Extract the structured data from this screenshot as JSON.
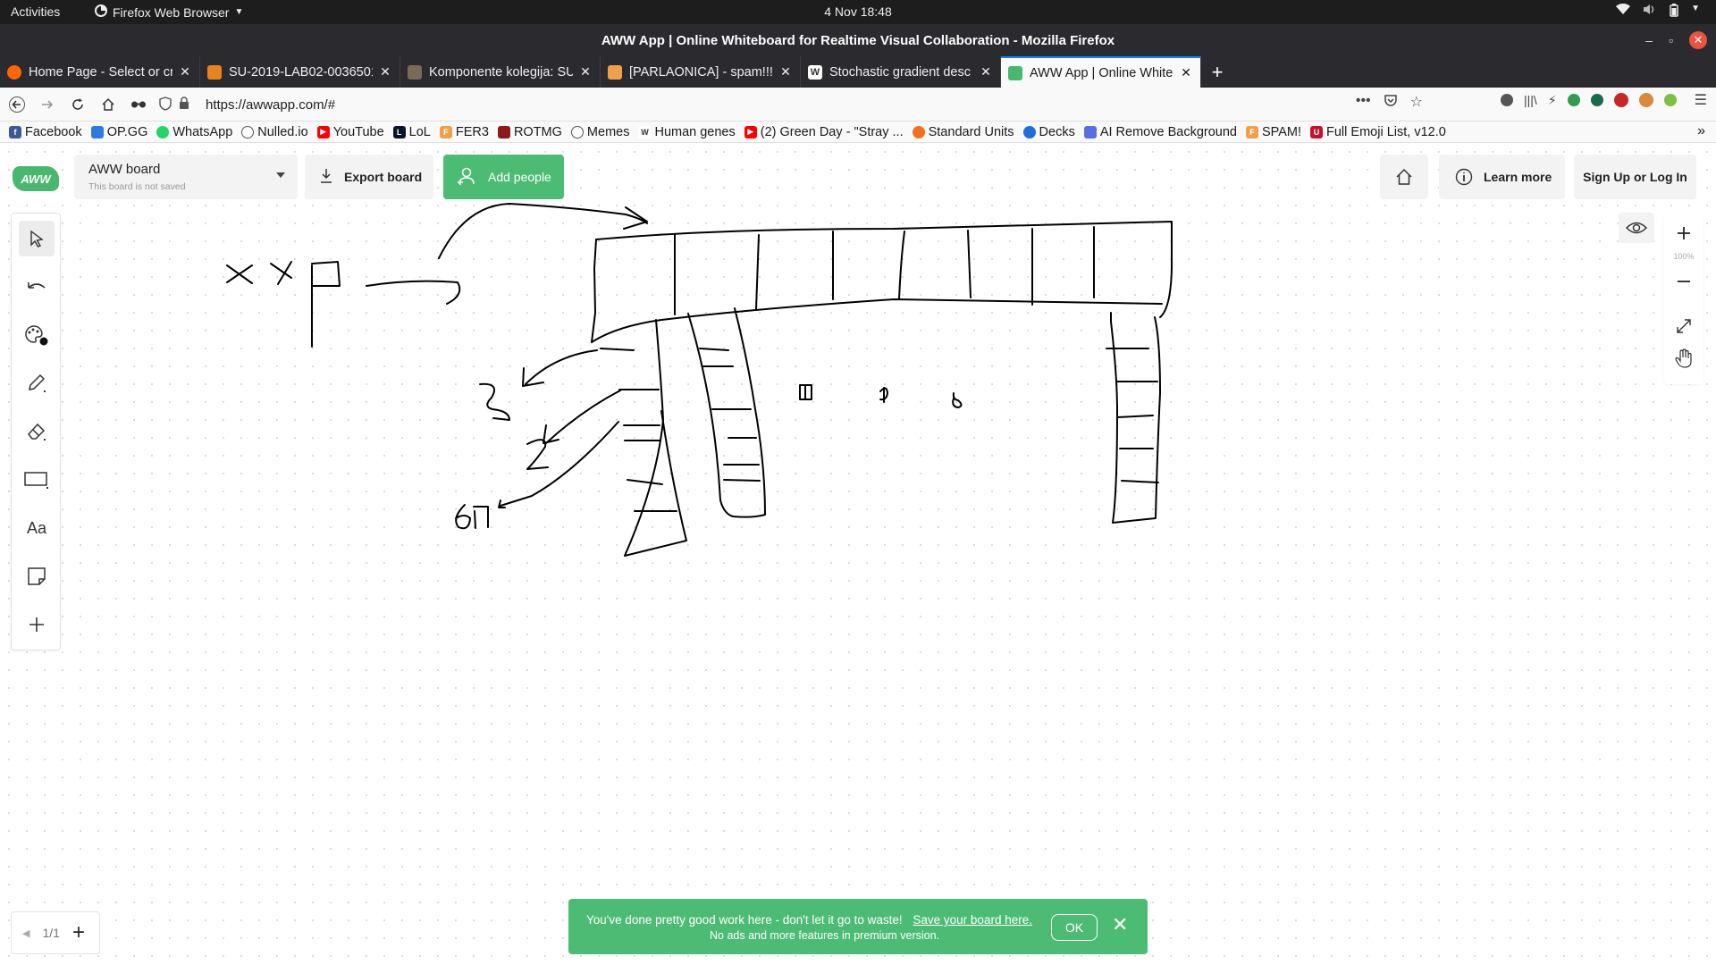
{
  "system": {
    "activities": "Activities",
    "app_menu": "Firefox Web Browser",
    "clock": "4 Nov  18:48"
  },
  "window": {
    "title": "AWW App | Online Whiteboard for Realtime Visual Collaboration - Mozilla Firefox"
  },
  "tabs": [
    {
      "title": "Home Page - Select or cr",
      "favicon_color": "#ff6600"
    },
    {
      "title": "SU-2019-LAB02-0036501",
      "favicon_color": "#e8831d"
    },
    {
      "title": "Komponente kolegija: SU",
      "favicon_color": "#7a6a58"
    },
    {
      "title": "[PARLAONICA] - spam!!!",
      "favicon_color": "#f0a04b"
    },
    {
      "title": "Stochastic gradient desc",
      "favicon_color": "#333333"
    },
    {
      "title": "AWW App | Online White",
      "favicon_color": "#47b86e"
    }
  ],
  "navbar": {
    "url": "https://awwapp.com/#",
    "more": "•••"
  },
  "bookmarks": [
    {
      "label": "Facebook",
      "color": "#3b5998"
    },
    {
      "label": "OP.GG",
      "color": "#2c7be5"
    },
    {
      "label": "WhatsApp",
      "color": "#25d366"
    },
    {
      "label": "Nulled.io",
      "color": "#555555"
    },
    {
      "label": "YouTube",
      "color": "#ff0000"
    },
    {
      "label": "LoL",
      "color": "#0a1428"
    },
    {
      "label": "FER3",
      "color": "#f0a04b"
    },
    {
      "label": "ROTMG",
      "color": "#8b1a1a"
    },
    {
      "label": "Memes",
      "color": "#555555"
    },
    {
      "label": "Human genes",
      "color": "#333333"
    },
    {
      "label": "(2) Green Day - \"Stray ...",
      "color": "#ff0000"
    },
    {
      "label": "Standard Units",
      "color": "#f2711c"
    },
    {
      "label": "Decks",
      "color": "#1e6fd9"
    },
    {
      "label": "AI Remove Background",
      "color": "#5b6ee1"
    },
    {
      "label": "SPAM!",
      "color": "#f0a04b"
    },
    {
      "label": "Full Emoji List, v12.0",
      "color": "#c8102e"
    }
  ],
  "app": {
    "logo": "AWW",
    "board_name": "AWW board",
    "board_status": "This board is not saved",
    "export_label": "Export board",
    "add_people_label": "Add people",
    "learn_more_label": "Learn more",
    "signup_label": "Sign Up or Log In",
    "zoom_level": "100%",
    "page_indicator": "1/1",
    "accent_color": "#4cbc74"
  },
  "toast": {
    "message": "You've done pretty good work here - don't let it go to waste!",
    "link": "Save your board here.",
    "sub": "No ads and more features in premium version.",
    "ok": "OK"
  }
}
